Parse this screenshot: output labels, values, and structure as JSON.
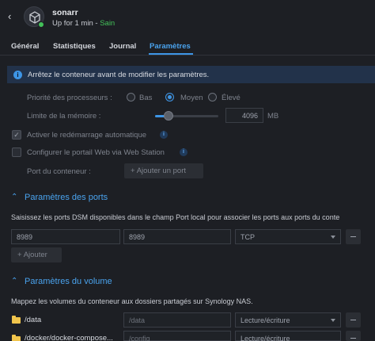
{
  "header": {
    "app_name": "sonarr",
    "uptime": "Up for 1 min",
    "separator": " - ",
    "health": "Sain"
  },
  "tabs": [
    {
      "label": "Général"
    },
    {
      "label": "Statistiques"
    },
    {
      "label": "Journal"
    },
    {
      "label": "Paramètres",
      "active": true
    }
  ],
  "info": {
    "text": "Arrêtez le conteneur avant de modifier les paramètres."
  },
  "cpu": {
    "label": "Priorité des processeurs :",
    "options": [
      "Bas",
      "Moyen",
      "Élevé"
    ],
    "selected": "Moyen"
  },
  "memory": {
    "label": "Limite de la mémoire :",
    "value": "4096",
    "unit": "MB",
    "slider_level": 0.17
  },
  "auto_restart": {
    "label": "Activer le redémarrage automatique",
    "checked": true
  },
  "web_portal": {
    "label": "Configurer le portail Web via Web Station",
    "checked": false
  },
  "container_port": {
    "label": "Port du conteneur :",
    "add_button": "Ajouter un port"
  },
  "ports_section": {
    "title": "Paramètres des ports",
    "description": "Saisissez les ports DSM disponibles dans le champ Port local pour associer les ports aux ports du conte",
    "rows": [
      {
        "local_port": "8989",
        "container_port": "8989",
        "protocol": "TCP"
      }
    ],
    "add_button": "Ajouter"
  },
  "volume_section": {
    "title": "Paramètres du volume",
    "description": "Mappez les volumes du conteneur aux dossiers partagés sur Synology NAS.",
    "rows": [
      {
        "folder": "/data",
        "mount": "/data",
        "mode": "Lecture/écriture"
      },
      {
        "folder": "/docker/docker-compose...",
        "mount": "/config",
        "mode": "Lecture/écriture"
      }
    ]
  },
  "icons": {
    "back": "chevron-left-icon",
    "info": "info-icon",
    "plus": "plus-icon",
    "chevron_up": "chevron-up-icon",
    "folder": "folder-icon",
    "minus": "minus-icon"
  },
  "colors": {
    "accent": "#3d95e6",
    "ok": "#43c059",
    "background": "#1d1f24",
    "folder": "#f0c44c"
  }
}
